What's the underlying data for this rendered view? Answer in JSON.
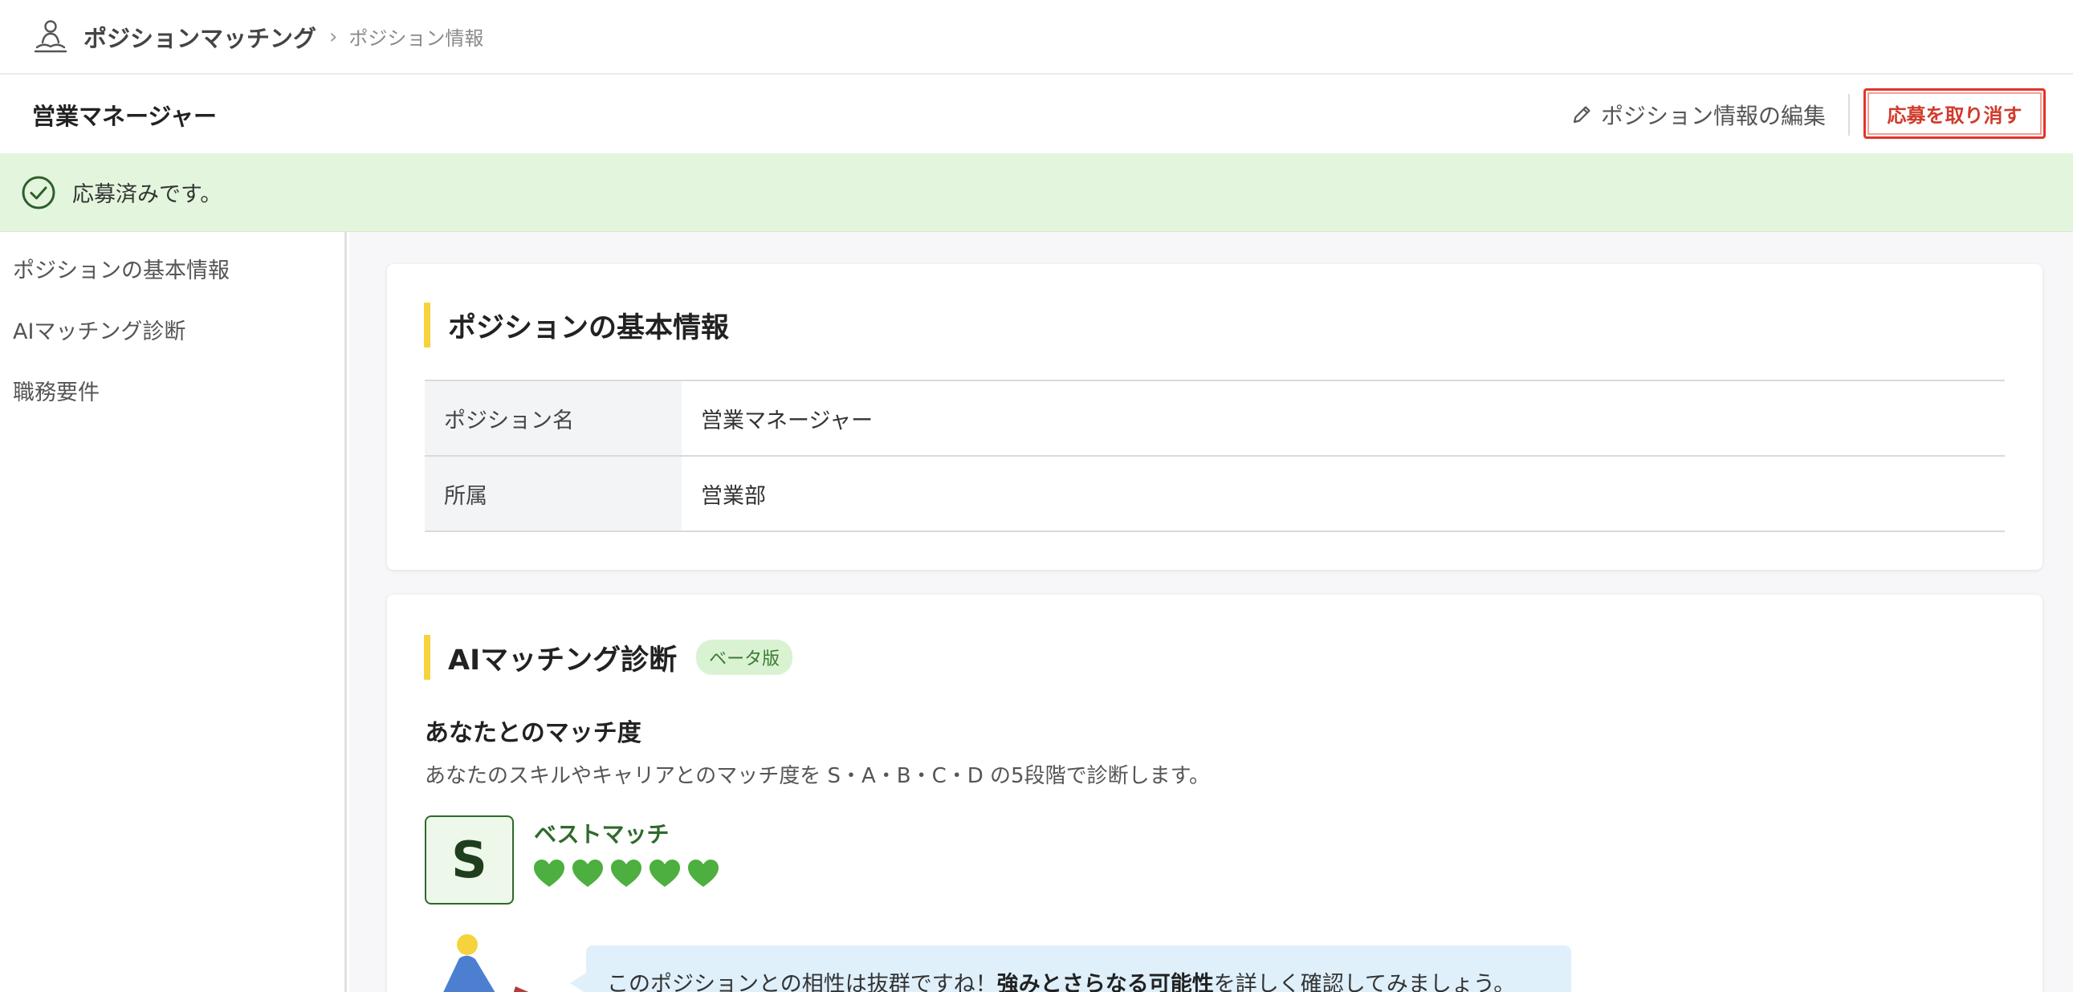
{
  "app": {
    "title": "ポジションマッチング",
    "breadcrumb_current": "ポジション情報"
  },
  "header": {
    "title": "営業マネージャー",
    "edit_label": "ポジション情報の編集",
    "cancel_label": "応募を取り消す"
  },
  "banner": {
    "text": "応募済みです。"
  },
  "sidebar": {
    "items": [
      {
        "label": "ポジションの基本情報"
      },
      {
        "label": "AIマッチング診断"
      },
      {
        "label": "職務要件"
      }
    ]
  },
  "basic_info": {
    "title": "ポジションの基本情報",
    "rows": [
      {
        "label": "ポジション名",
        "value": "営業マネージャー"
      },
      {
        "label": "所属",
        "value": "営業部"
      }
    ]
  },
  "ai_matching": {
    "title": "AIマッチング診断",
    "badge": "ベータ版",
    "match_title": "あなたとのマッチ度",
    "match_desc": "あなたのスキルやキャリアとのマッチ度を S・A・B・C・D の5段階で診断します。",
    "grade": "S",
    "grade_label": "ベストマッチ",
    "hearts": 5,
    "bubble_text_1": "このポジションとの相性は抜群ですね！",
    "bubble_bold": "強みとさらなる可能性",
    "bubble_text_2": "を詳しく確認してみましょう。"
  },
  "colors": {
    "accent_bar": "#f6d33c",
    "cancel_red": "#d23a2c",
    "banner_bg": "#e3f6dd",
    "grade_green": "#2f6a2c",
    "heart_green": "#4caf3f"
  },
  "icons": {
    "logo": "person-meditation-icon",
    "breadcrumb_separator": "chevron-right-icon",
    "edit": "pencil-icon",
    "banner": "check-circle-icon",
    "heart": "heart-icon"
  }
}
